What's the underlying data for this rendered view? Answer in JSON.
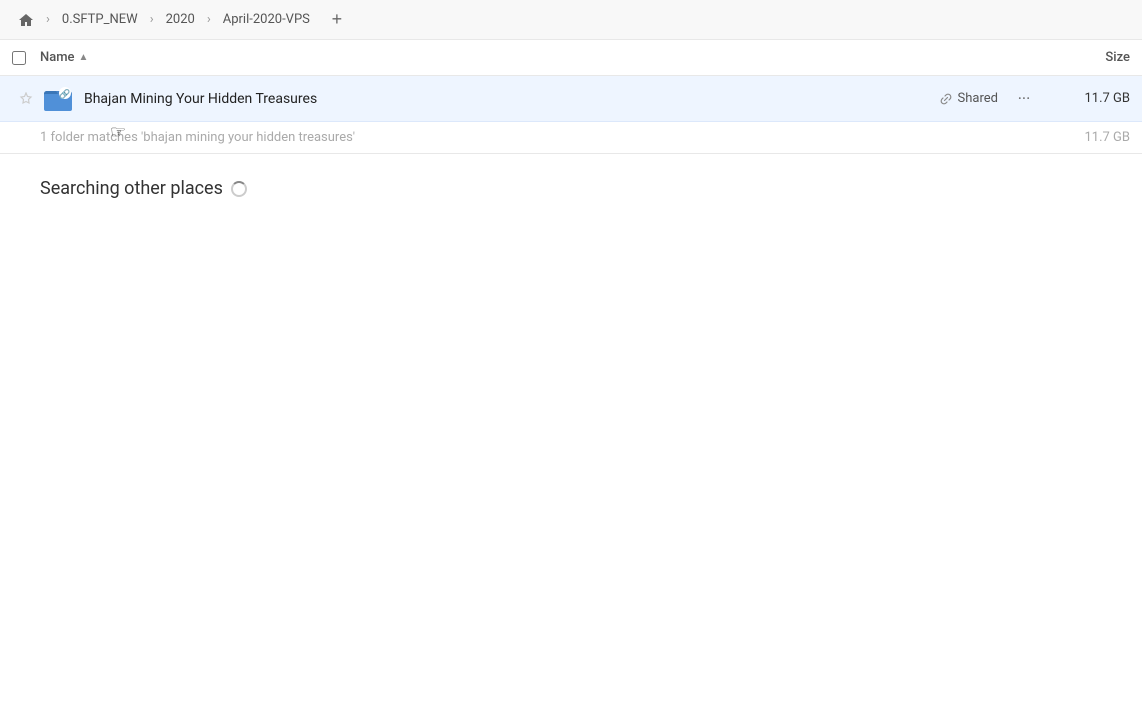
{
  "breadcrumb": {
    "home_label": "Home",
    "items": [
      {
        "label": "0.SFTP_NEW"
      },
      {
        "label": "2020"
      },
      {
        "label": "April-2020-VPS"
      }
    ],
    "add_tab_label": "+"
  },
  "columns": {
    "name_label": "Name",
    "sort_indicator": "▲",
    "size_label": "Size"
  },
  "file_row": {
    "name": "Bhajan Mining Your Hidden Treasures",
    "shared_label": "Shared",
    "size": "11.7 GB"
  },
  "summary": {
    "text": "1 folder matches 'bhajan mining your hidden treasures'",
    "size": "11.7 GB"
  },
  "searching_section": {
    "label": "Searching other places"
  }
}
